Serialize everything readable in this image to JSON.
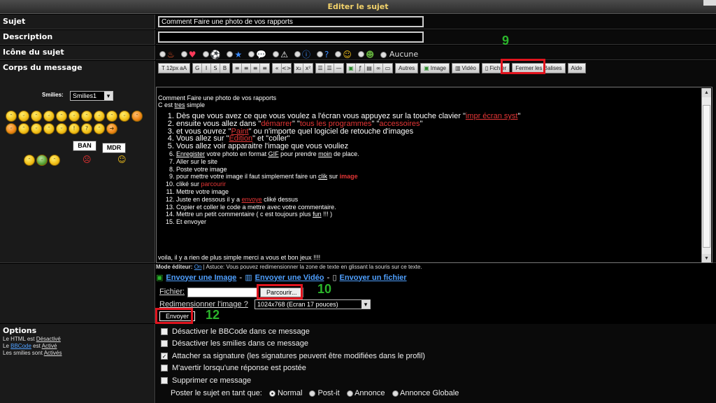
{
  "title": "Editer le sujet",
  "labels": {
    "subject": "Sujet",
    "description": "Description",
    "topic_icon": "Icône du sujet",
    "body": "Corps du message",
    "options": "Options"
  },
  "subject_value": "Comment Faire une photo de vos rapports",
  "description_value": "",
  "icon_none": "Aucune",
  "toolbar": {
    "size": "12px",
    "autres": "Autres",
    "image": "Image",
    "video": "Vidéo",
    "fichier": "Fichier",
    "fermer": "Fermer les Balises",
    "aide": "Aide"
  },
  "smilies": {
    "label": "Smilies:",
    "selected": "Smilies1",
    "sign1": "BAN",
    "sign2": "MDR"
  },
  "editor": {
    "line1": "Comment Faire une photo de vos rapports",
    "line2_a": "C est ",
    "line2_b": "tres",
    "line2_c": " simple",
    "items": [
      [
        "Dès que vous avez ce que vous voulez a l'écran vous appuyez sur la touche clavier \"",
        "impr écran syst",
        "\""
      ],
      [
        "ensuite vous allez dans \"",
        "démarrer",
        "\" \"",
        "tous les programmes",
        "\" \"",
        "accessoires",
        "\""
      ],
      [
        "et vous ouvrez \"",
        "Paint",
        "\" ou n'importe quel logiciel de retouche d'images"
      ],
      [
        "Vous allez sur \"",
        "Edition",
        "\" et \"coller\""
      ],
      [
        "Vous allez voir apparaitre l'image que vous vouliez"
      ],
      [
        "Enregister",
        " votre photo en  format ",
        "GIF",
        " pour prendre ",
        "moin",
        "  de place."
      ],
      [
        "Aller sur le site"
      ],
      [
        "Poste votre image"
      ],
      [
        "pour mettre votre image il  faut simplement faire un  ",
        "clik",
        "  sur ",
        "image"
      ],
      [
        "cliké sur ",
        "parcourir"
      ],
      [
        "Mettre votre image"
      ],
      [
        "Juste en dessous il y a ",
        "envoye",
        "  cliké dessus"
      ],
      [
        "Copier et coller le code a mettre avec votre commentaire."
      ],
      [
        "Mettre un petit commentaire ( c est  toujours plus ",
        "fun",
        " !!! )"
      ],
      [
        "Et envoyer"
      ]
    ],
    "footer": "voila, il y  a rien  de plus simple merci  a vous et bon  jeux !!!!"
  },
  "mode": {
    "label": "Mode éditeur:",
    "value": "On",
    "tip": "| Astuce: Vous pouvez redimensionner la zone de texte en glissant la souris sur ce texte."
  },
  "uploads": {
    "image": "Envoyer une Image",
    "video": "Envoyer une Vidéo",
    "file": "Envoyer un fichier"
  },
  "fichier_label": "Fichier:",
  "parcourir": "Parcourir...",
  "resize_label": "Redimensionner l'image ?",
  "resize_value": "1024x768 (Ecran 17 pouces)",
  "envoyer": "Envoyer",
  "annotations": {
    "n9": "9",
    "n10": "10",
    "n12": "12"
  },
  "options_side": {
    "html_a": "Le HTML est ",
    "html_b": "Désactivé",
    "bb_a": "Le ",
    "bb_b": "BBCode",
    "bb_c": " est ",
    "bb_d": "Activé",
    "sm_a": "Les smilies sont ",
    "sm_b": "Activés"
  },
  "options": [
    {
      "label": "Désactiver le BBCode dans ce message",
      "checked": false
    },
    {
      "label": "Désactiver les smilies dans ce message",
      "checked": false
    },
    {
      "label": "Attacher sa signature (les signatures peuvent être modifiées dans le profil)",
      "checked": true
    },
    {
      "label": "M'avertir lorsqu'une réponse est postée",
      "checked": false
    },
    {
      "label": "Supprimer ce message",
      "checked": false
    }
  ],
  "post_as": {
    "label": "Poster le sujet en tant que:",
    "choices": [
      "Normal",
      "Post-it",
      "Annonce",
      "Annonce Globale"
    ],
    "selected": "Normal"
  }
}
